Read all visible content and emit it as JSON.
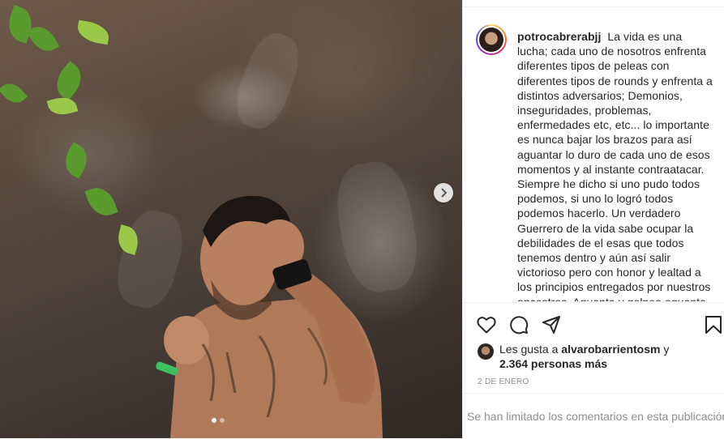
{
  "post": {
    "username": "potrocabrerabjj",
    "caption": "La vida es una lucha; cada uno de nosotros enfrenta diferentes tipos de peleas con diferentes tipos de rounds y enfrenta a distintos adversarios; Demonios, inseguridades, problemas, enfermedades etc, etc... lo importante es nunca bajar los brazos para así aguantar lo duro de cada uno de esos momentos y al instante contraatacar. Siempre he dicho si uno pudo todos podemos, si uno lo logró todos podemos hacerlo. Un verdadero Guerrero de la vida sabe ocupar la debilidades de el esas que todos tenemos dentro y aún así salir victorioso pero con honor y lealtad a los principios entregados por nuestros ancestros. Aguanta y golpea aguanta",
    "likes_prefix": "Les gusta a",
    "likes_user": "alvarobarrientosm",
    "likes_connector": "y",
    "likes_others": "2.364 personas más",
    "date": "2 DE ENERO",
    "comments_limited": "Se han limitado los comentarios en esta publicación"
  },
  "carousel": {
    "total_slides": 2,
    "active_slide": 1
  },
  "icons": {
    "like": "heart-icon",
    "comment": "comment-icon",
    "share": "share-icon",
    "save": "bookmark-icon",
    "next": "chevron-right-icon"
  },
  "colors": {
    "text": "#262626",
    "secondary_text": "#8e8e8e",
    "border": "#efefef"
  }
}
